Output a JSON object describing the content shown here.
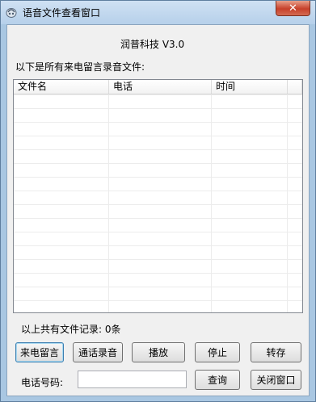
{
  "window": {
    "title": "语音文件查看窗口",
    "close_label": "✕"
  },
  "brand": "润普科技 V3.0",
  "list_caption": "以下是所有来电留言录音文件:",
  "table": {
    "columns": [
      "文件名",
      "电话",
      "时间"
    ],
    "rows": []
  },
  "record_count": "以上共有文件记录: 0条",
  "buttons": {
    "voicemail": "来电留言",
    "call_recording": "通话录音",
    "play": "播放",
    "stop": "停止",
    "save_as": "转存",
    "query": "查询",
    "close_window": "关闭窗口"
  },
  "phone": {
    "label": "电话号码:",
    "value": "",
    "placeholder": ""
  }
}
